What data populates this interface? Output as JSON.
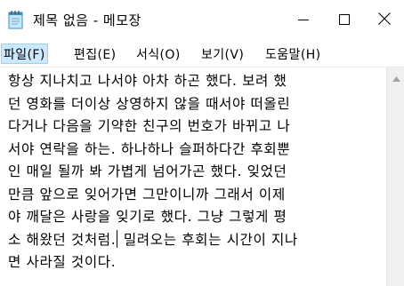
{
  "window": {
    "title": "제목 없음 - 메모장"
  },
  "menu": {
    "items": [
      {
        "label": "파일(F)"
      },
      {
        "label": "편집(E)"
      },
      {
        "label": "서식(O)"
      },
      {
        "label": "보기(V)"
      },
      {
        "label": "도움말(H)"
      }
    ]
  },
  "editor": {
    "lines": [
      "항상 지나치고 나서야 아차 하곤 했다. 보려 했",
      "던 영화를 더이상 상영하지 않을 때서야 떠올린",
      "다거나 다음을 기약한 친구의 번호가 바뀌고 나",
      "서야 연락을 하는. 하나하나 슬퍼하다간 후회뿐",
      "인 매일 될까 봐 가볍게 넘어가곤 했다. 잊었던",
      "만큼 앞으로 잊어가면 그만이니까 그래서 이제",
      "야 깨달은 사랑을 잊기로 했다. 그냥 그렇게 평"
    ],
    "caret_line_before": "소 해왔던 것처럼.",
    "caret_line_after": " 밀려오는 후회는 시간이 지나",
    "last_line": "면 사라질 것이다."
  },
  "icons": {
    "app": "notepad-icon",
    "minimize": "minimize-icon",
    "maximize": "maximize-icon",
    "close": "close-icon",
    "scroll_up": "chevron-up-icon"
  },
  "colors": {
    "menu_highlight": "#cce8ff",
    "menu_highlight_border": "#99d1ff",
    "scrollbar_track": "#f0f0f0"
  }
}
